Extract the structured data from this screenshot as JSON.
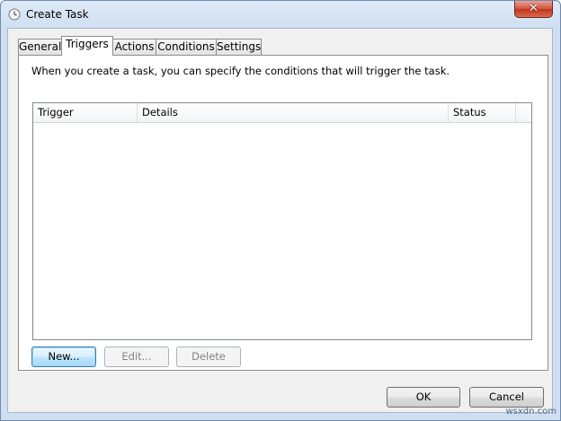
{
  "window": {
    "title": "Create Task",
    "close_glyph": "✕"
  },
  "tabs": [
    {
      "label": "General",
      "active": false
    },
    {
      "label": "Triggers",
      "active": true
    },
    {
      "label": "Actions",
      "active": false
    },
    {
      "label": "Conditions",
      "active": false
    },
    {
      "label": "Settings",
      "active": false
    }
  ],
  "panel": {
    "description": "When you create a task, you can specify the conditions that will trigger the task.",
    "columns": [
      "Trigger",
      "Details",
      "Status"
    ],
    "rows": []
  },
  "buttons": {
    "new": "New...",
    "edit": "Edit...",
    "delete": "Delete",
    "ok": "OK",
    "cancel": "Cancel"
  },
  "watermark": "wsxdn.com"
}
